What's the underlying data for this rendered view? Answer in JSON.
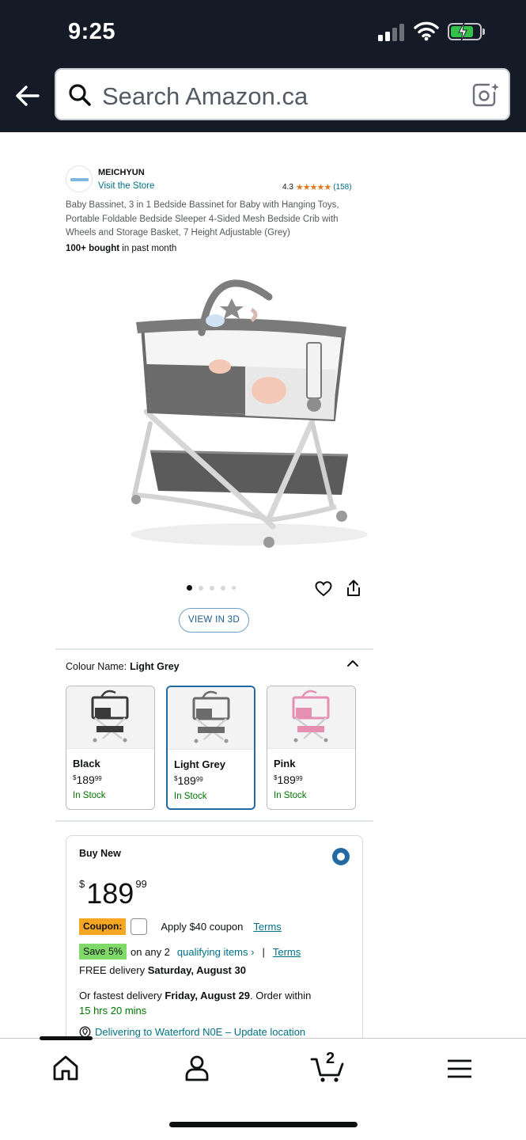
{
  "status_bar": {
    "time": "9:25"
  },
  "search": {
    "placeholder": "Search Amazon.ca"
  },
  "product": {
    "brand": "MEICHYUN",
    "visit_store": "Visit the Store",
    "rating_value": "4.3",
    "stars": "★★★★★",
    "review_count": "(158)",
    "title": "Baby Bassinet, 3 in 1 Bedside Bassinet for Baby with Hanging Toys, Portable Foldable Bedside Sleeper 4-Sided Mesh Bedside Crib with Wheels and Storage Basket, 7 Height Adjustable (Grey)",
    "bought_bold": "100+ bought",
    "bought_rest": " in past month",
    "image_count": 5,
    "active_image": 1,
    "view_3d": "VIEW IN 3D"
  },
  "colour": {
    "label": "Colour Name:",
    "selected": "Light Grey",
    "options": [
      {
        "name": "Black",
        "currency": "$",
        "whole": "189",
        "cents": "99",
        "stock": "In Stock",
        "tone": "#3a3a3a"
      },
      {
        "name": "Light Grey",
        "currency": "$",
        "whole": "189",
        "cents": "99",
        "stock": "In Stock",
        "tone": "#6b6b6b"
      },
      {
        "name": "Pink",
        "currency": "$",
        "whole": "189",
        "cents": "99",
        "stock": "In Stock",
        "tone": "#e58fb2"
      }
    ]
  },
  "buy_box": {
    "title": "Buy New",
    "currency": "$",
    "price_whole": "189",
    "price_cents": "99",
    "coupon_label": "Coupon:",
    "coupon_text": "Apply $40 coupon",
    "terms": "Terms",
    "save_label": "Save 5%",
    "save_text": "on any 2",
    "qualifying": "qualifying items ›",
    "separator": "|",
    "delivery_prefix": "FREE delivery ",
    "delivery_date": "Saturday, August 30",
    "fast_prefix": "Or fastest delivery ",
    "fast_date": "Friday, August 29",
    "fast_mid": ". Order within",
    "countdown": "15 hrs 20 mins",
    "location": "Delivering to Waterford N0E – Update location"
  },
  "nav": {
    "cart_count": "2"
  },
  "colors": {
    "header_bg": "#141b26",
    "link": "#007185",
    "in_stock": "#007600",
    "selected_border": "#236aa3",
    "coupon": "#f5a623",
    "save": "#7fda69"
  }
}
